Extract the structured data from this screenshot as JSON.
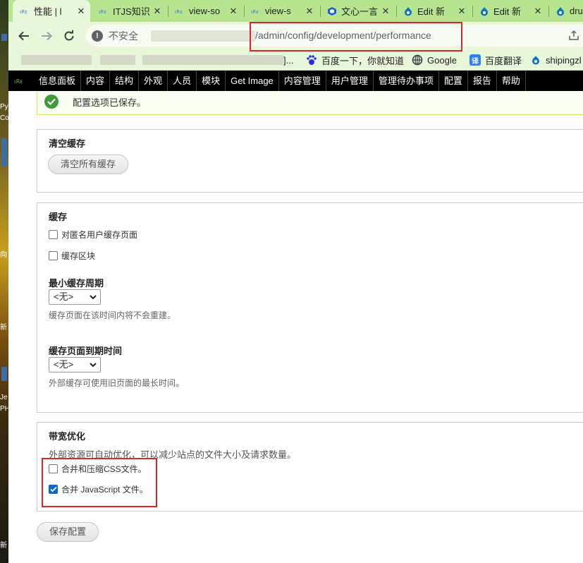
{
  "tabs": [
    {
      "title": "性能 | l",
      "active": true
    },
    {
      "title": "ITJS知识"
    },
    {
      "title": "view-so"
    },
    {
      "title": "view-s"
    },
    {
      "title": "文心一言"
    },
    {
      "title": "Edit 新"
    },
    {
      "title": "Edit 新"
    },
    {
      "title": "dru"
    }
  ],
  "address": {
    "security_label": "不安全",
    "url_path": "/admin/config/development/performance"
  },
  "bookmarks": [
    {
      "label": "]...",
      "icon": "blank"
    },
    {
      "label": "百度一下，你就知道",
      "icon": "paw-icon"
    },
    {
      "label": "Google",
      "icon": "globe-icon"
    },
    {
      "label": "百度翻译",
      "icon": "translate-icon"
    },
    {
      "label": "shipingzl",
      "icon": "drupal-icon"
    }
  ],
  "admin_menu": [
    "信息面板",
    "内容",
    "结构",
    "外观",
    "人员",
    "模块",
    "Get Image",
    "内容管理",
    "用户管理",
    "管理待办事项",
    "配置",
    "报告",
    "帮助"
  ],
  "status_message": "配置选项已保存。",
  "clear_cache": {
    "legend": "清空缓存",
    "button": "清空所有缓存"
  },
  "caching": {
    "legend": "缓存",
    "anon_cache": {
      "label": "对匿名用户缓存页面",
      "checked": false
    },
    "block_cache": {
      "label": "缓存区块",
      "checked": false
    },
    "min_lifetime": {
      "label": "最小缓存周期",
      "value": "<无>",
      "description": "缓存页面在该时间内将不会重建。"
    },
    "max_age": {
      "label": "缓存页面到期时间",
      "value": "<无>",
      "description": "外部缓存可使用旧页面的最长时间。"
    }
  },
  "bandwidth": {
    "legend": "带宽优化",
    "description": "外部资源可自动优化，可以减少站点的文件大小及请求数量。",
    "css": {
      "label": "合并和压缩CSS文件。",
      "checked": false
    },
    "js": {
      "label": "合并 JavaScript 文件。",
      "checked": true
    }
  },
  "save_button": "保存配置",
  "desktop_labels": [
    "Py",
    "Co",
    "向",
    "新",
    "Je",
    "PH",
    "新"
  ],
  "colors": {
    "tabbar": "#b7e58f",
    "toolbar": "#e8f6d9",
    "highlight": "#e0242c",
    "admin_menu": "#000000"
  }
}
